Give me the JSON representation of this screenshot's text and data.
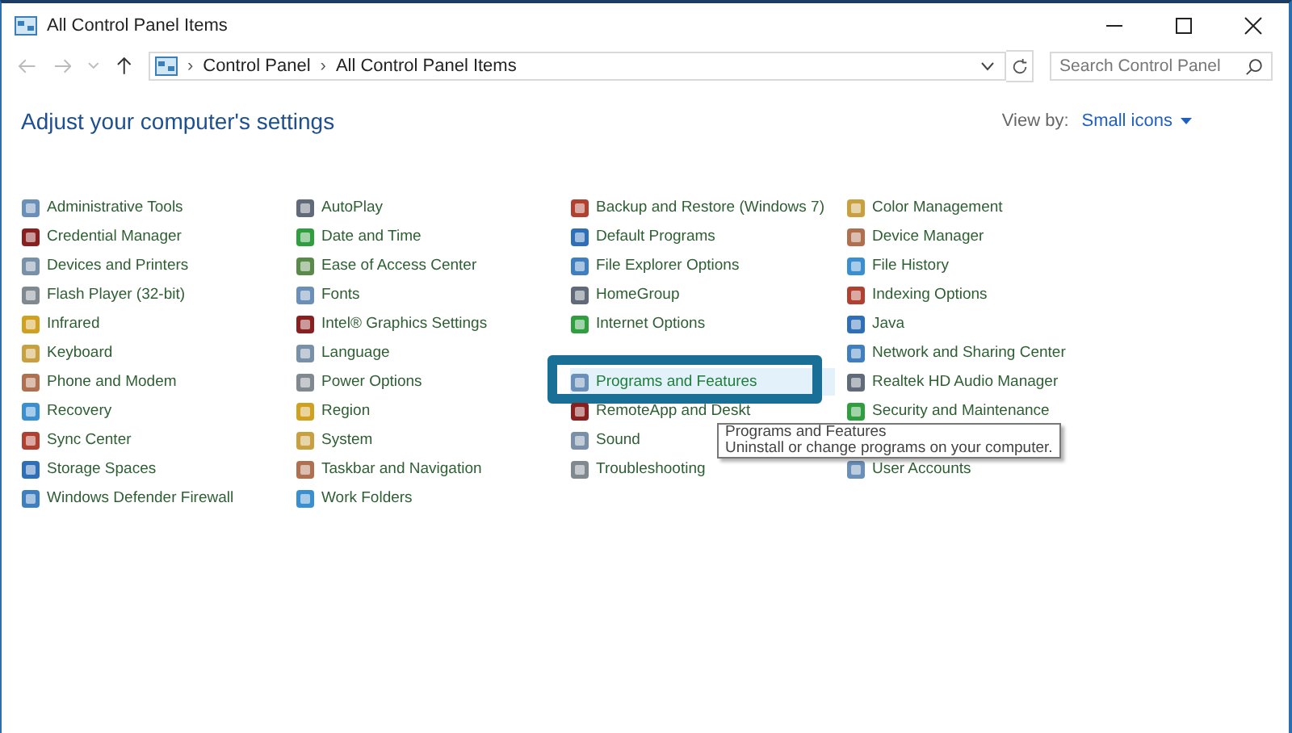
{
  "window": {
    "title": "All Control Panel Items"
  },
  "address": {
    "crumbs": [
      "Control Panel",
      "All Control Panel Items"
    ],
    "separator": "›"
  },
  "search": {
    "placeholder": "Search Control Panel"
  },
  "heading": "Adjust your computer's settings",
  "view_by": {
    "label": "View by:",
    "value": "Small icons"
  },
  "columns": [
    [
      {
        "label": "Administrative Tools",
        "selected": false
      },
      {
        "label": "Credential Manager",
        "selected": false
      },
      {
        "label": "Devices and Printers",
        "selected": false
      },
      {
        "label": "Flash Player (32-bit)",
        "selected": false
      },
      {
        "label": "Infrared",
        "selected": false
      },
      {
        "label": "Keyboard",
        "selected": false
      },
      {
        "label": "Phone and Modem",
        "selected": false
      },
      {
        "label": "Recovery",
        "selected": false
      },
      {
        "label": "Sync Center",
        "selected": false
      },
      {
        "label": "Storage Spaces",
        "selected": false
      },
      {
        "label": "Windows Defender Firewall",
        "selected": false
      }
    ],
    [
      {
        "label": "AutoPlay",
        "selected": false
      },
      {
        "label": "Date and Time",
        "selected": false
      },
      {
        "label": "Ease of Access Center",
        "selected": false
      },
      {
        "label": "Fonts",
        "selected": false
      },
      {
        "label": "Intel® Graphics Settings",
        "selected": false
      },
      {
        "label": "Language",
        "selected": false
      },
      {
        "label": "Power Options",
        "selected": false
      },
      {
        "label": "Region",
        "selected": false
      },
      {
        "label": "System",
        "selected": false
      },
      {
        "label": "Taskbar and Navigation",
        "selected": false
      },
      {
        "label": "Work Folders",
        "selected": false
      }
    ],
    [
      {
        "label": "Backup and Restore (Windows 7)",
        "selected": false
      },
      {
        "label": "Default Programs",
        "selected": false
      },
      {
        "label": "File Explorer Options",
        "selected": false
      },
      {
        "label": "HomeGroup",
        "selected": false
      },
      {
        "label": "Internet Options",
        "selected": false
      },
      {
        "kind": "covered"
      },
      {
        "label": "Programs and Features",
        "selected": true
      },
      {
        "label": "RemoteApp and Deskt",
        "selected": false
      },
      {
        "label": "Sound",
        "selected": false
      },
      {
        "label": "Troubleshooting",
        "selected": false
      }
    ],
    [
      {
        "label": "Color Management",
        "selected": false
      },
      {
        "label": "Device Manager",
        "selected": false
      },
      {
        "label": "File History",
        "selected": false
      },
      {
        "label": "Indexing Options",
        "selected": false
      },
      {
        "label": "Java",
        "selected": false
      },
      {
        "label": "Network and Sharing Center",
        "selected": false
      },
      {
        "label": "Realtek HD Audio Manager",
        "selected": false
      },
      {
        "label": "Security and Maintenance",
        "selected": false
      },
      {
        "kind": "covered"
      },
      {
        "label": "User Accounts",
        "selected": false
      }
    ]
  ],
  "tooltip": {
    "title": "Programs and Features",
    "text": "Uninstall or change programs on your computer."
  }
}
